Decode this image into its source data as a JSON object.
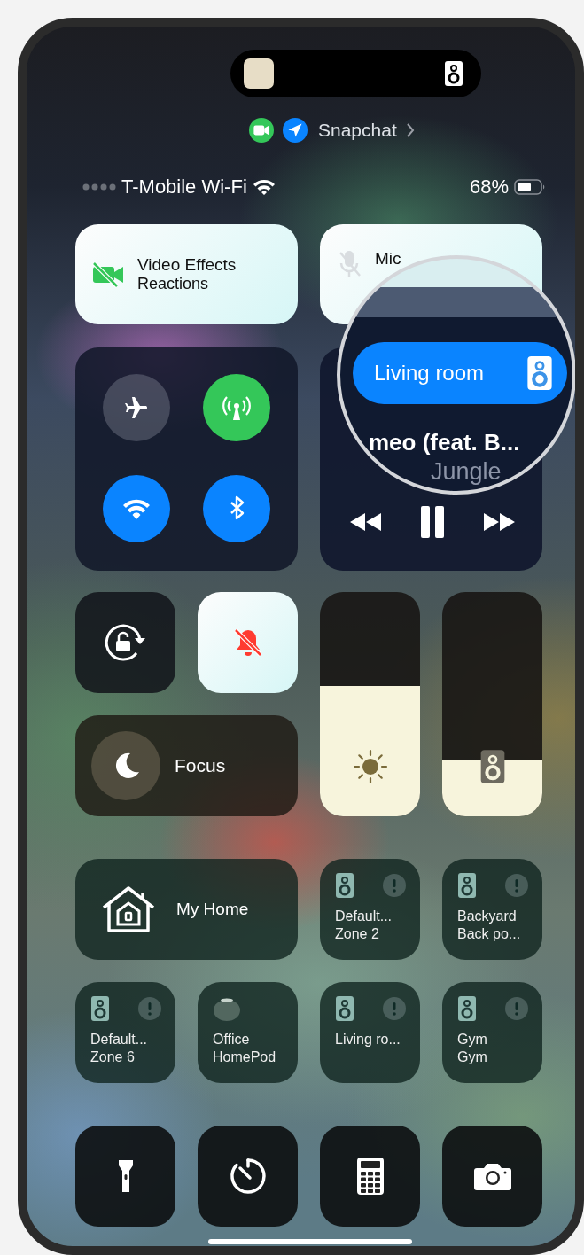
{
  "privacy_indicators": [
    {
      "kind": "camera",
      "color": "#34c759"
    },
    {
      "kind": "location",
      "color": "#0a84ff"
    }
  ],
  "privacy_app": "Snapchat",
  "status_bar": {
    "carrier": "T-Mobile Wi-Fi",
    "battery": "68%"
  },
  "top_tiles": [
    {
      "kind": "video_effects",
      "title": "Video Effects",
      "subtitle": "Reactions",
      "on": true
    },
    {
      "kind": "mic",
      "title": "Mic",
      "on": true
    }
  ],
  "connectivity": [
    {
      "kind": "airplane",
      "on": false
    },
    {
      "kind": "cellular",
      "on": true
    },
    {
      "kind": "wifi",
      "on": true
    },
    {
      "kind": "bluetooth",
      "on": true
    }
  ],
  "now_playing": {
    "output": "Living room",
    "title": "meo (feat. B...",
    "artist": "Jungle",
    "playing": true
  },
  "orientation_lock": {
    "on": false
  },
  "silent_mode": {
    "on": true
  },
  "focus": {
    "label": "Focus"
  },
  "brightness": {
    "level": 0.58
  },
  "volume": {
    "level": 0.25
  },
  "home": {
    "label": "My Home"
  },
  "accessories": [
    {
      "kind": "speaker",
      "line1": "Default...",
      "line2": "Zone 2",
      "alert": true
    },
    {
      "kind": "speaker",
      "line1": "Backyard",
      "line2": "Back po...",
      "alert": true
    },
    {
      "kind": "speaker",
      "line1": "Default...",
      "line2": "Zone 6",
      "alert": true
    },
    {
      "kind": "homepod",
      "line1": "Office",
      "line2": "HomePod",
      "alert": false
    },
    {
      "kind": "speaker",
      "line1": "Living ro...",
      "alert": true
    },
    {
      "kind": "speaker",
      "line1": "Gym",
      "line2": "Gym",
      "alert": true
    }
  ],
  "shortcuts": [
    {
      "kind": "flashlight"
    },
    {
      "kind": "timer"
    },
    {
      "kind": "calculator"
    },
    {
      "kind": "camera"
    }
  ]
}
